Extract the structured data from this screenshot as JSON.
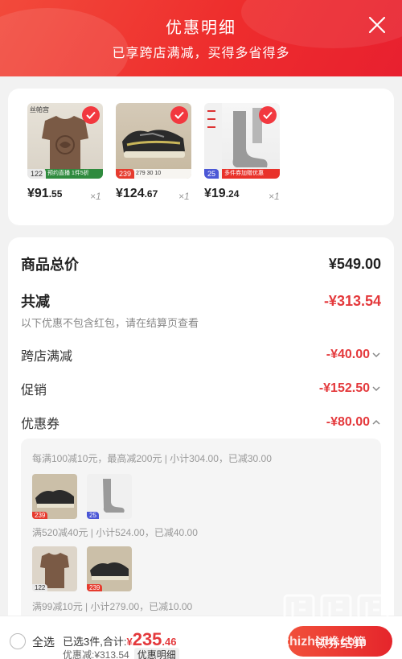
{
  "header": {
    "title": "优惠明细",
    "subtitle": "已享跨店满减，买得多省得多",
    "close_icon": "close-icon"
  },
  "products": [
    {
      "image": "brown-tshirt",
      "price_main": "¥91",
      "price_decimal": ".55",
      "qty": "×1",
      "badge": "122",
      "strip": "预约直播 1件5折",
      "brand_mark": "丝帕宫"
    },
    {
      "image": "black-sneaker",
      "price_main": "¥124",
      "price_decimal": ".67",
      "qty": "×1",
      "badge": "239",
      "strip": "279  30  10"
    },
    {
      "image": "gray-sock",
      "price_main": "¥19",
      "price_decimal": ".24",
      "qty": "×1",
      "badge": "25",
      "strip": "多件券加赠优惠"
    }
  ],
  "summary": {
    "total_label": "商品总价",
    "total_value": "¥549.00",
    "discount_label": "共减",
    "discount_value": "-¥313.54",
    "note": "以下优惠不包含红包，请在结算页查看",
    "rows": [
      {
        "label": "跨店满减",
        "value": "-¥40.00",
        "chevron": "chevron-down-icon"
      },
      {
        "label": "促销",
        "value": "-¥152.50",
        "chevron": "chevron-down-icon"
      },
      {
        "label": "优惠券",
        "value": "-¥80.00",
        "chevron": "chevron-up-icon"
      }
    ]
  },
  "coupons": [
    {
      "text": "每满100减10元，最高减200元 | 小计304.00，已减30.00",
      "thumbs": [
        {
          "kind": "shoe",
          "badge": "239"
        },
        {
          "kind": "sock",
          "badge": "25"
        }
      ]
    },
    {
      "text": "满520减40元 | 小计524.00，已减40.00",
      "thumbs": [
        {
          "kind": "tee",
          "badge": "122"
        },
        {
          "kind": "shoe",
          "badge": "239"
        }
      ]
    },
    {
      "text": "满99减10元 | 小计279.00，已减10.00",
      "thumbs": []
    }
  ],
  "bottom": {
    "select_all": "全选",
    "selected_text": "已选3件,合计:",
    "yen": "¥",
    "amount_main": "235",
    "amount_decimal": ".46",
    "saved_text": "优惠减:¥313.54",
    "detail_label": "优惠明细",
    "checkout_label": "领券结算"
  },
  "watermark": {
    "text": "值 值 值",
    "site": "zhizhizhi.com"
  },
  "colors": {
    "accent": "#e4393c",
    "header": "#ee2d2d"
  }
}
